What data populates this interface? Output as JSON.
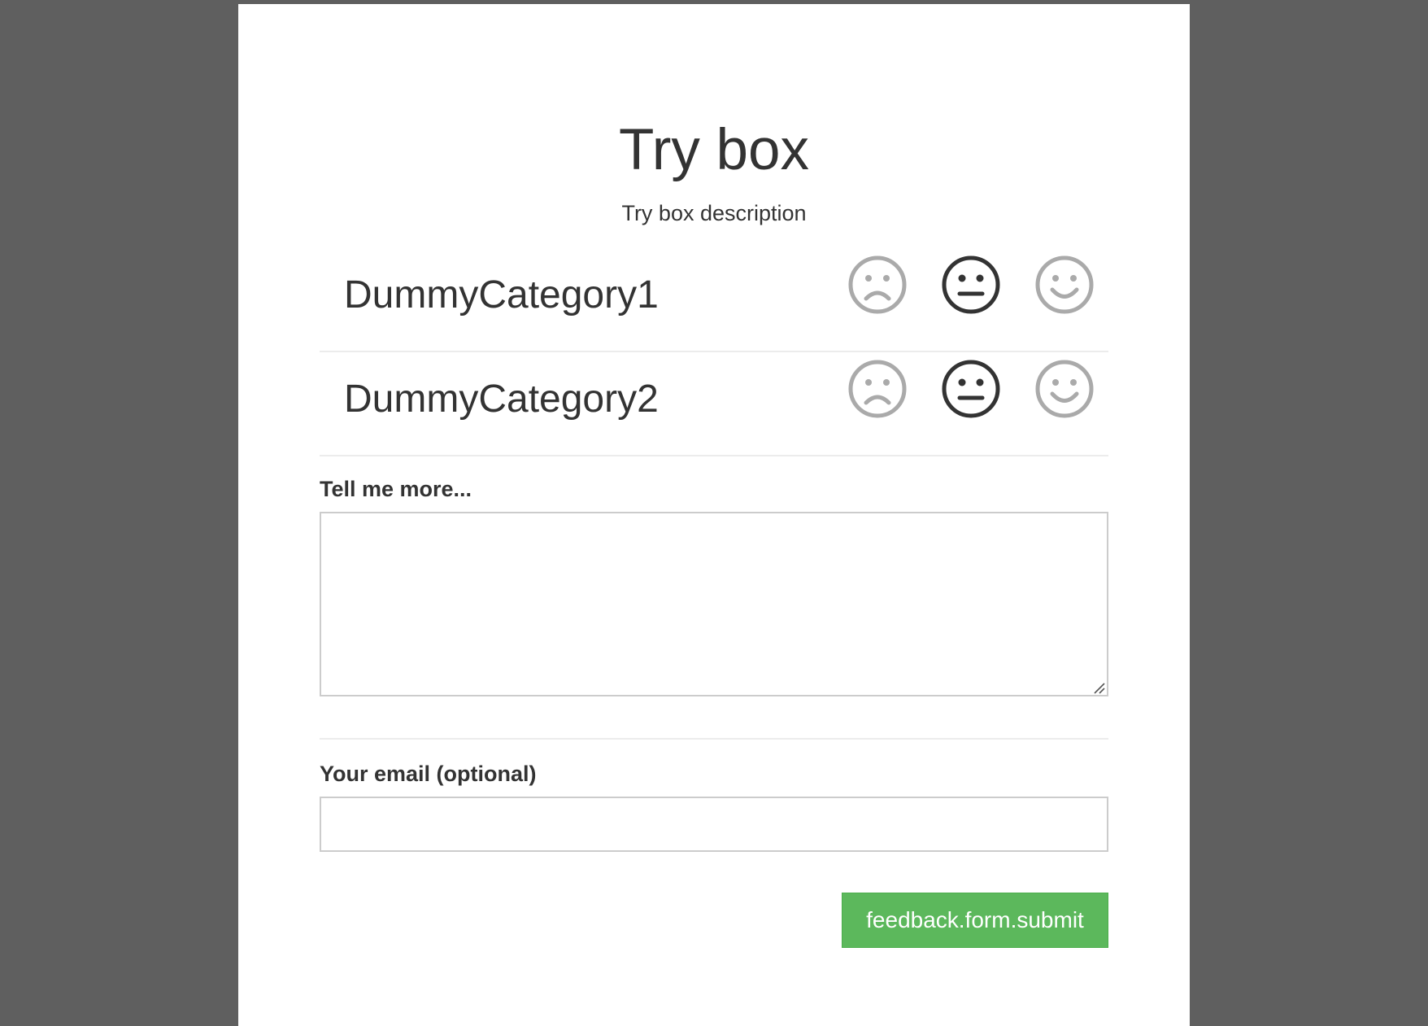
{
  "form": {
    "title": "Try box",
    "description": "Try box description",
    "categories": [
      {
        "label": "DummyCategory1",
        "selected_rating": "neutral"
      },
      {
        "label": "DummyCategory2",
        "selected_rating": "neutral"
      }
    ],
    "rating_options": [
      "sad-face-icon",
      "neutral-face-icon",
      "happy-face-icon"
    ],
    "comment_label": "Tell me more...",
    "comment_value": "",
    "email_label": "Your email (optional)",
    "email_value": "",
    "submit_label": "feedback.form.submit"
  },
  "colors": {
    "page_background": "#5f5f5f",
    "panel_background": "#ffffff",
    "text": "#333333",
    "icon_selected": "#333333",
    "icon_unselected": "#aaaaaa",
    "submit_background": "#5cb85c",
    "submit_text": "#ffffff"
  }
}
